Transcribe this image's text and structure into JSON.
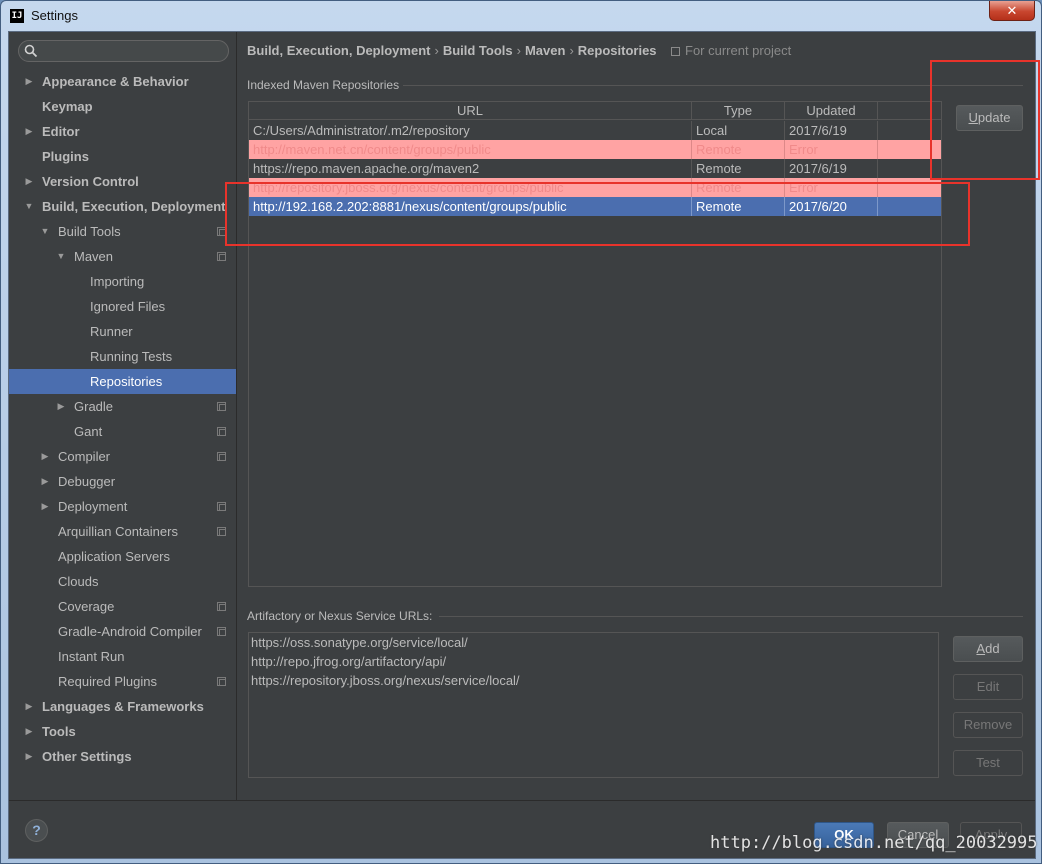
{
  "window": {
    "title": "Settings",
    "app_icon": "IJ",
    "close_glyph": "✕"
  },
  "search": {
    "placeholder": ""
  },
  "sidebar": {
    "items": [
      {
        "label": "Appearance & Behavior",
        "level": 0,
        "arrow": "▶",
        "bold": true
      },
      {
        "label": "Keymap",
        "level": 0,
        "arrow": "",
        "bold": true
      },
      {
        "label": "Editor",
        "level": 0,
        "arrow": "▶",
        "bold": true
      },
      {
        "label": "Plugins",
        "level": 0,
        "arrow": "",
        "bold": true
      },
      {
        "label": "Version Control",
        "level": 0,
        "arrow": "▶",
        "bold": true
      },
      {
        "label": "Build, Execution, Deployment",
        "level": 0,
        "arrow": "▼",
        "bold": true
      },
      {
        "label": "Build Tools",
        "level": 1,
        "arrow": "▼",
        "copy": true
      },
      {
        "label": "Maven",
        "level": 2,
        "arrow": "▼",
        "copy": true
      },
      {
        "label": "Importing",
        "level": 3,
        "arrow": ""
      },
      {
        "label": "Ignored Files",
        "level": 3,
        "arrow": ""
      },
      {
        "label": "Runner",
        "level": 3,
        "arrow": ""
      },
      {
        "label": "Running Tests",
        "level": 3,
        "arrow": ""
      },
      {
        "label": "Repositories",
        "level": 3,
        "arrow": "",
        "selected": true
      },
      {
        "label": "Gradle",
        "level": 2,
        "arrow": "▶",
        "copy": true
      },
      {
        "label": "Gant",
        "level": 2,
        "arrow": "",
        "copy": true
      },
      {
        "label": "Compiler",
        "level": 1,
        "arrow": "▶",
        "copy": true
      },
      {
        "label": "Debugger",
        "level": 1,
        "arrow": "▶"
      },
      {
        "label": "Deployment",
        "level": 1,
        "arrow": "▶",
        "copy": true
      },
      {
        "label": "Arquillian Containers",
        "level": 1,
        "arrow": "",
        "copy": true
      },
      {
        "label": "Application Servers",
        "level": 1,
        "arrow": ""
      },
      {
        "label": "Clouds",
        "level": 1,
        "arrow": ""
      },
      {
        "label": "Coverage",
        "level": 1,
        "arrow": "",
        "copy": true
      },
      {
        "label": "Gradle-Android Compiler",
        "level": 1,
        "arrow": "",
        "copy": true
      },
      {
        "label": "Instant Run",
        "level": 1,
        "arrow": ""
      },
      {
        "label": "Required Plugins",
        "level": 1,
        "arrow": "",
        "copy": true
      },
      {
        "label": "Languages & Frameworks",
        "level": 0,
        "arrow": "▶",
        "bold": true
      },
      {
        "label": "Tools",
        "level": 0,
        "arrow": "▶",
        "bold": true
      },
      {
        "label": "Other Settings",
        "level": 0,
        "arrow": "▶",
        "bold": true
      }
    ]
  },
  "breadcrumb": {
    "items": [
      "Build, Execution, Deployment",
      "Build Tools",
      "Maven",
      "Repositories"
    ],
    "separator": "›",
    "note": "For current project"
  },
  "indexed": {
    "label": "Indexed Maven Repositories",
    "columns": [
      "URL",
      "Type",
      "Updated"
    ],
    "rows": [
      {
        "url": "C:/Users/Administrator/.m2/repository",
        "type": "Local",
        "updated": "2017/6/19",
        "state": "normal"
      },
      {
        "url": "http://maven.net.cn/content/groups/public",
        "type": "Remote",
        "updated": "Error",
        "state": "error"
      },
      {
        "url": "https://repo.maven.apache.org/maven2",
        "type": "Remote",
        "updated": "2017/6/19",
        "state": "normal"
      },
      {
        "url": "http://repository.jboss.org/nexus/content/groups/public",
        "type": "Remote",
        "updated": "Error",
        "state": "error"
      },
      {
        "url": "http://192.168.2.202:8881/nexus/content/groups/public",
        "type": "Remote",
        "updated": "2017/6/20",
        "state": "selected"
      }
    ],
    "update_button": {
      "label_u": "U",
      "label_rest": "pdate"
    }
  },
  "services": {
    "label": "Artifactory or Nexus Service URLs:",
    "urls": [
      "https://oss.sonatype.org/service/local/",
      "http://repo.jfrog.org/artifactory/api/",
      "https://repository.jboss.org/nexus/service/local/"
    ],
    "buttons": {
      "add_u": "A",
      "add_rest": "dd",
      "edit": "Edit",
      "remove": "Remove",
      "test": "Test"
    }
  },
  "footer": {
    "help": "?",
    "ok": "OK",
    "cancel": "Cancel",
    "apply": "Apply"
  },
  "watermark": "http://blog.csdn.net/qq_20032995",
  "colors": {
    "accent": "#4b6eaf",
    "error_row": "#ffa3a3",
    "annotation": "#e8332b"
  }
}
